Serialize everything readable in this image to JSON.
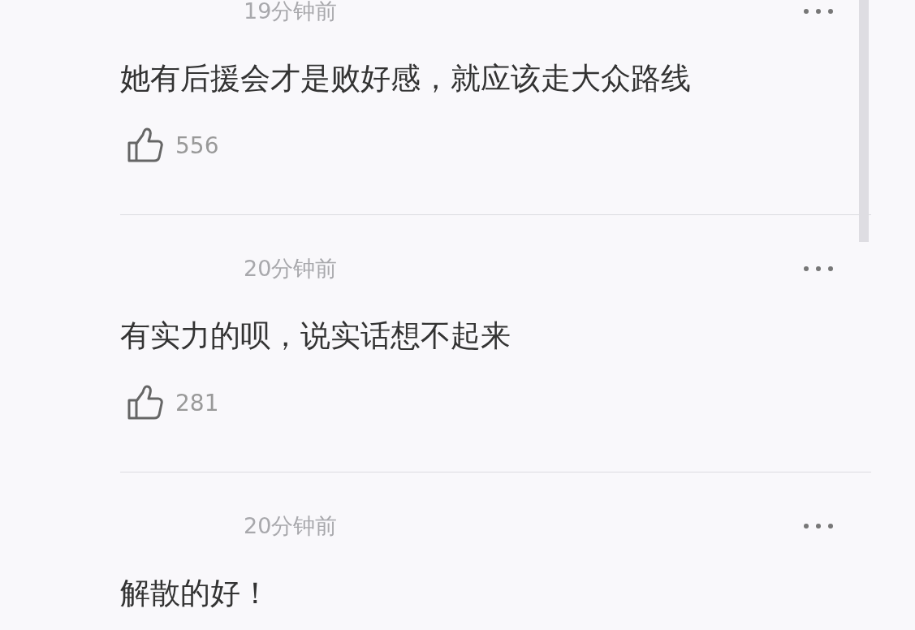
{
  "comments": [
    {
      "time": "19分钟前",
      "text": "她有后援会才是败好感，就应该走大众路线",
      "likes": "556"
    },
    {
      "time": "20分钟前",
      "text": "有实力的呗，说实话想不起来",
      "likes": "281"
    },
    {
      "time": "20分钟前",
      "text": "解散的好！"
    }
  ]
}
